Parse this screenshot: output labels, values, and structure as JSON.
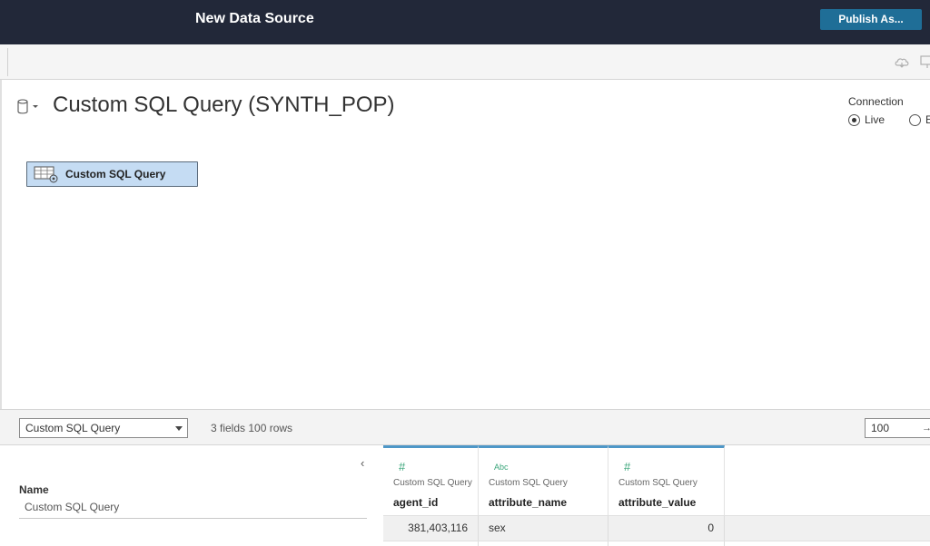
{
  "topbar": {
    "title": "New Data Source",
    "publish_label": "Publish As..."
  },
  "toolbar": {
    "icons": [
      "cloud-icon",
      "window-icon"
    ]
  },
  "datasource": {
    "title": "Custom SQL Query (SYNTH_POP)",
    "connection_label": "Connection",
    "connection_options": [
      {
        "label": "Live",
        "selected": true
      },
      {
        "label": "E",
        "selected": false
      }
    ],
    "canvas_table_label": "Custom SQL Query"
  },
  "grid_toolbar": {
    "table_select_value": "Custom SQL Query",
    "field_count_text": "3 fields 100 rows",
    "rows_value": "100"
  },
  "details": {
    "name_label": "Name",
    "name_value": "Custom SQL Query"
  },
  "grid": {
    "columns": [
      {
        "type_icon": "#",
        "source": "Custom SQL Query",
        "name": "agent_id"
      },
      {
        "type_icon": "Abc",
        "source": "Custom SQL Query",
        "name": "attribute_name"
      },
      {
        "type_icon": "#",
        "source": "Custom SQL Query",
        "name": "attribute_value"
      }
    ],
    "rows": [
      [
        "381,403,116",
        "sex",
        "0"
      ]
    ]
  },
  "colors": {
    "topbar_bg": "#222839",
    "publish_bg": "#1f6e97",
    "pill_bg": "#c5dcf3",
    "header_accent": "#4e97c7",
    "type_icon": "#3aa57a"
  }
}
